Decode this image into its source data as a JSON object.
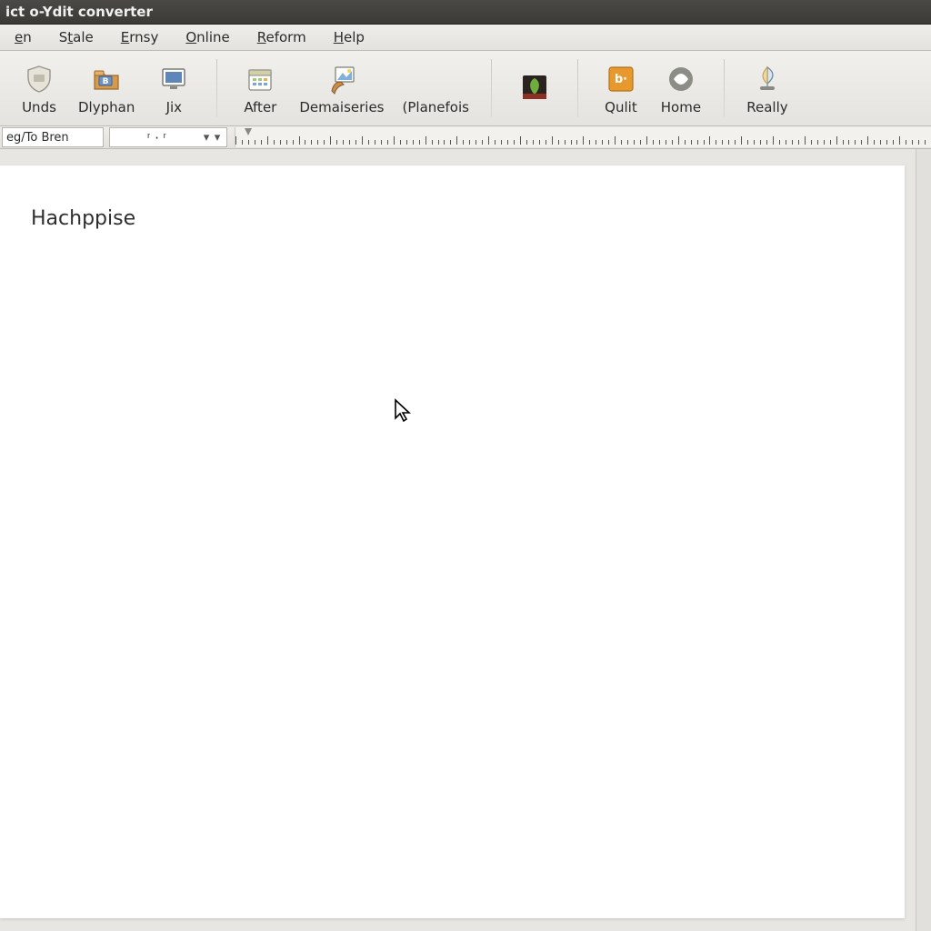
{
  "window": {
    "title": "ict o-Ydit converter"
  },
  "menubar": {
    "items": [
      {
        "pre": "",
        "accel": "e",
        "post": "n"
      },
      {
        "pre": "S",
        "accel": "t",
        "post": "ale"
      },
      {
        "pre": "",
        "accel": "E",
        "post": "rnsy"
      },
      {
        "pre": "",
        "accel": "O",
        "post": "nline"
      },
      {
        "pre": "",
        "accel": "R",
        "post": "eform"
      },
      {
        "pre": "",
        "accel": "H",
        "post": "elp"
      }
    ]
  },
  "toolbar": {
    "buttons": [
      {
        "icon": "shield-icon",
        "label": "Unds"
      },
      {
        "icon": "folder-b-icon",
        "label": "Dlyphan"
      },
      {
        "icon": "screen-icon",
        "label": "Jix"
      },
      {
        "sep": true
      },
      {
        "icon": "calendar-icon",
        "label": "After"
      },
      {
        "icon": "brush-photo-icon",
        "label": "Demaiseries"
      },
      {
        "icon": "label-blank",
        "label": "(Planefois"
      },
      {
        "sep": true
      },
      {
        "icon": "leaf-dark-icon",
        "label": ""
      },
      {
        "sep": true
      },
      {
        "icon": "bp-orange-icon",
        "label": "Qulit"
      },
      {
        "icon": "swirl-icon",
        "label": "Home"
      },
      {
        "sep": true
      },
      {
        "icon": "sail-icon",
        "label": "Really"
      }
    ]
  },
  "stylestrip": {
    "style_selector": "eg/To Bren",
    "size_selector": "ʳ·ʳ"
  },
  "document": {
    "body_text": "Hachppise"
  }
}
